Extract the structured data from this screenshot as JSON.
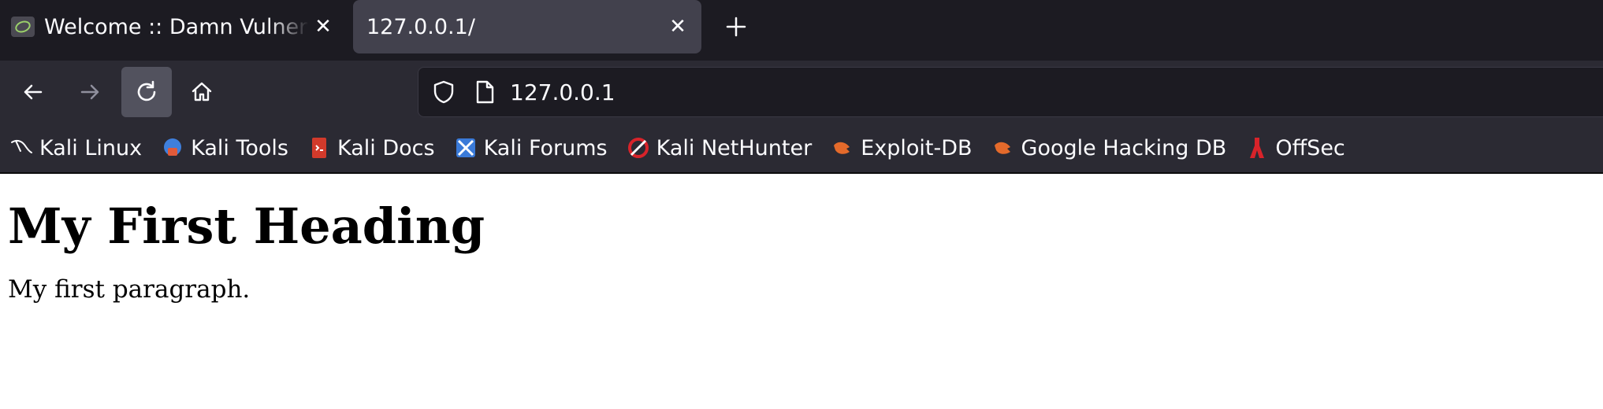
{
  "tabs": [
    {
      "title": "Welcome :: Damn Vulnerable Web Application",
      "active": false
    },
    {
      "title": "127.0.0.1/",
      "active": true
    }
  ],
  "toolbar": {
    "url": "127.0.0.1"
  },
  "bookmarks": [
    {
      "label": "Kali Linux",
      "icon": "kali-dragon-icon"
    },
    {
      "label": "Kali Tools",
      "icon": "kali-tools-icon"
    },
    {
      "label": "Kali Docs",
      "icon": "kali-docs-icon"
    },
    {
      "label": "Kali Forums",
      "icon": "kali-forums-icon"
    },
    {
      "label": "Kali NetHunter",
      "icon": "kali-nethunter-icon"
    },
    {
      "label": "Exploit-DB",
      "icon": "exploit-db-icon"
    },
    {
      "label": "Google Hacking DB",
      "icon": "ghdb-icon"
    },
    {
      "label": "OffSec",
      "icon": "offsec-icon"
    }
  ],
  "page": {
    "heading": "My First Heading",
    "paragraph": "My first paragraph."
  },
  "colors": {
    "tabbar_bg": "#1c1b22",
    "toolbar_bg": "#2b2a33",
    "active_tab_bg": "#42414d",
    "text": "#fbfbfe"
  }
}
